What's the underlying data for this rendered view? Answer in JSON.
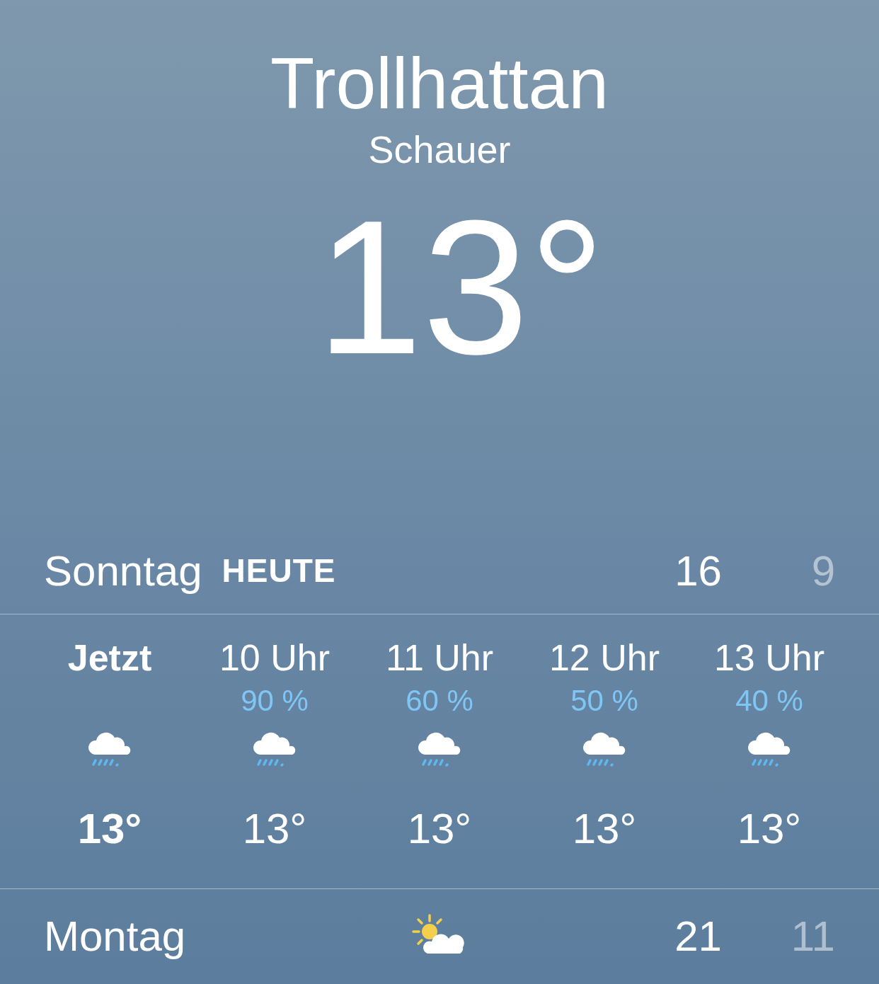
{
  "location": {
    "city": "Trollhattan",
    "condition": "Schauer",
    "temperature": "13°"
  },
  "today": {
    "day": "Sonntag",
    "badge": "HEUTE",
    "high": "16",
    "low": "9"
  },
  "hourly": [
    {
      "kind": "now",
      "time": "Jetzt",
      "temp": "13°"
    },
    {
      "kind": "hour",
      "time": "10 Uhr",
      "precip": "90 %",
      "temp": "13°"
    },
    {
      "kind": "hour",
      "time": "11 Uhr",
      "precip": "60 %",
      "temp": "13°"
    },
    {
      "kind": "hour",
      "time": "12 Uhr",
      "precip": "50 %",
      "temp": "13°"
    },
    {
      "kind": "hour",
      "time": "13 Uhr",
      "precip": "40 %",
      "temp": "13°"
    }
  ],
  "daily": [
    {
      "day": "Montag",
      "high": "21",
      "low": "11"
    }
  ]
}
